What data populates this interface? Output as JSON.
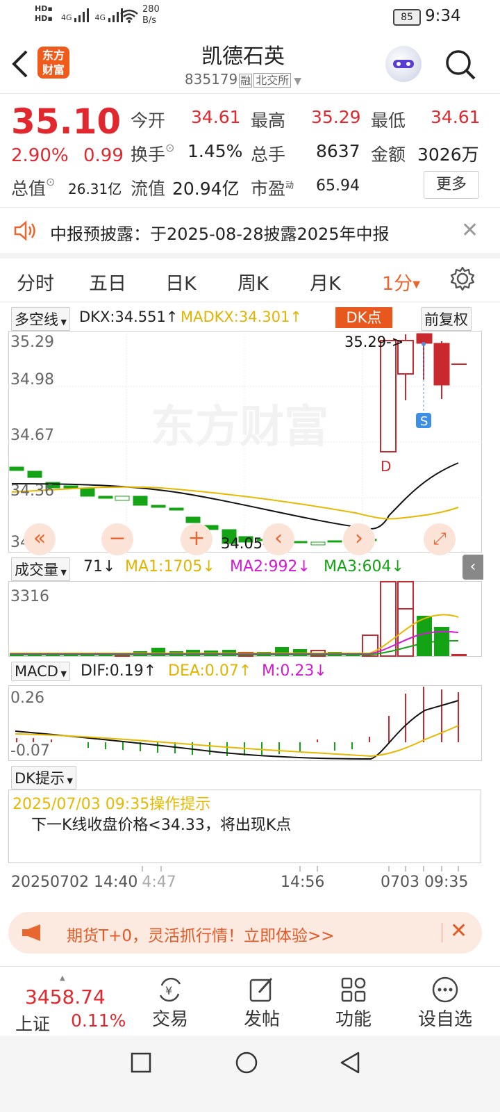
{
  "status_bar": {
    "hd1": "HD",
    "hd2": "HD",
    "sig1": "4G",
    "sig2": "4G",
    "net_speed_value": "280",
    "net_speed_unit": "B/s",
    "battery": "85",
    "time": "9:34"
  },
  "header": {
    "back_icon": "chevron-left-icon",
    "logo_text_line1": "东方",
    "logo_text_line2": "财富",
    "stock_name": "凯德石英",
    "stock_code": "835179",
    "tag_margin": "融",
    "exchange": "北交所",
    "search_icon": "search-icon"
  },
  "quote": {
    "price": "35.10",
    "change_pct": "2.90%",
    "change": "0.99",
    "open_label": "今开",
    "open": "34.61",
    "high_label": "最高",
    "high": "35.29",
    "low_label": "最低",
    "low": "34.61",
    "turnover_label": "换手",
    "turnover": "1.45%",
    "volume_label": "总手",
    "volume": "8637",
    "amount_label": "金额",
    "amount": "3026万",
    "mktcap_label": "总值",
    "mktcap": "26.31亿",
    "float_label": "流值",
    "float_cap": "20.94亿",
    "pe_label": "市盈",
    "pe_sup": "动",
    "pe": "65.94",
    "more_button": "更多"
  },
  "notice": {
    "text": "中报预披露：于2025-08-28披露2025年中报",
    "close_icon": "close-icon"
  },
  "tabs": {
    "items": [
      "分时",
      "五日",
      "日K",
      "周K",
      "月K"
    ],
    "active": "1分",
    "settings_icon": "gear-icon"
  },
  "kchart": {
    "indicator": "多空线",
    "dkx": "DKX:34.551",
    "madkx": "MADKX:34.301",
    "dk_button": "DK点",
    "adjust_button": "前复权",
    "y_labels": [
      "35.29",
      "34.98",
      "34.67",
      "34.36",
      "34.05"
    ],
    "high_marker": "35.29->",
    "low_marker": "34.05->",
    "d_marker": "D",
    "s_marker": "S",
    "watermark": "东方财富",
    "colors": {
      "up": "#c8282e",
      "down": "#14a314",
      "dkx": "#111111",
      "madkx": "#e6b800"
    }
  },
  "volume_chart": {
    "indicator": "成交量",
    "vol": "71",
    "ma1": "MA1:1705",
    "ma2": "MA2:992",
    "ma3": "MA3:604",
    "y_label": "3316"
  },
  "macd_chart": {
    "indicator": "MACD",
    "dif": "DIF:0.19",
    "dea": "DEA:0.07",
    "m": "M:0.23",
    "y_top": "0.26",
    "y_bottom": "-0.07"
  },
  "dk_tip": {
    "dropdown": "DK提示",
    "title": "2025/07/03 09:35操作提示",
    "body": "下一K线收盘价格<34.33，将出现K点"
  },
  "time_axis": {
    "left": "20250702 14:40",
    "left_suffix": "4:47",
    "mid": "14:56",
    "right": "0703 09:35"
  },
  "promo": {
    "text": "期货T+0，灵活抓行情！立即体验>>"
  },
  "bottom_nav": {
    "index_value": "3458.74",
    "index_name": "上证",
    "index_change": "0.11%",
    "items": [
      "交易",
      "发帖",
      "功能",
      "设自选"
    ]
  }
}
